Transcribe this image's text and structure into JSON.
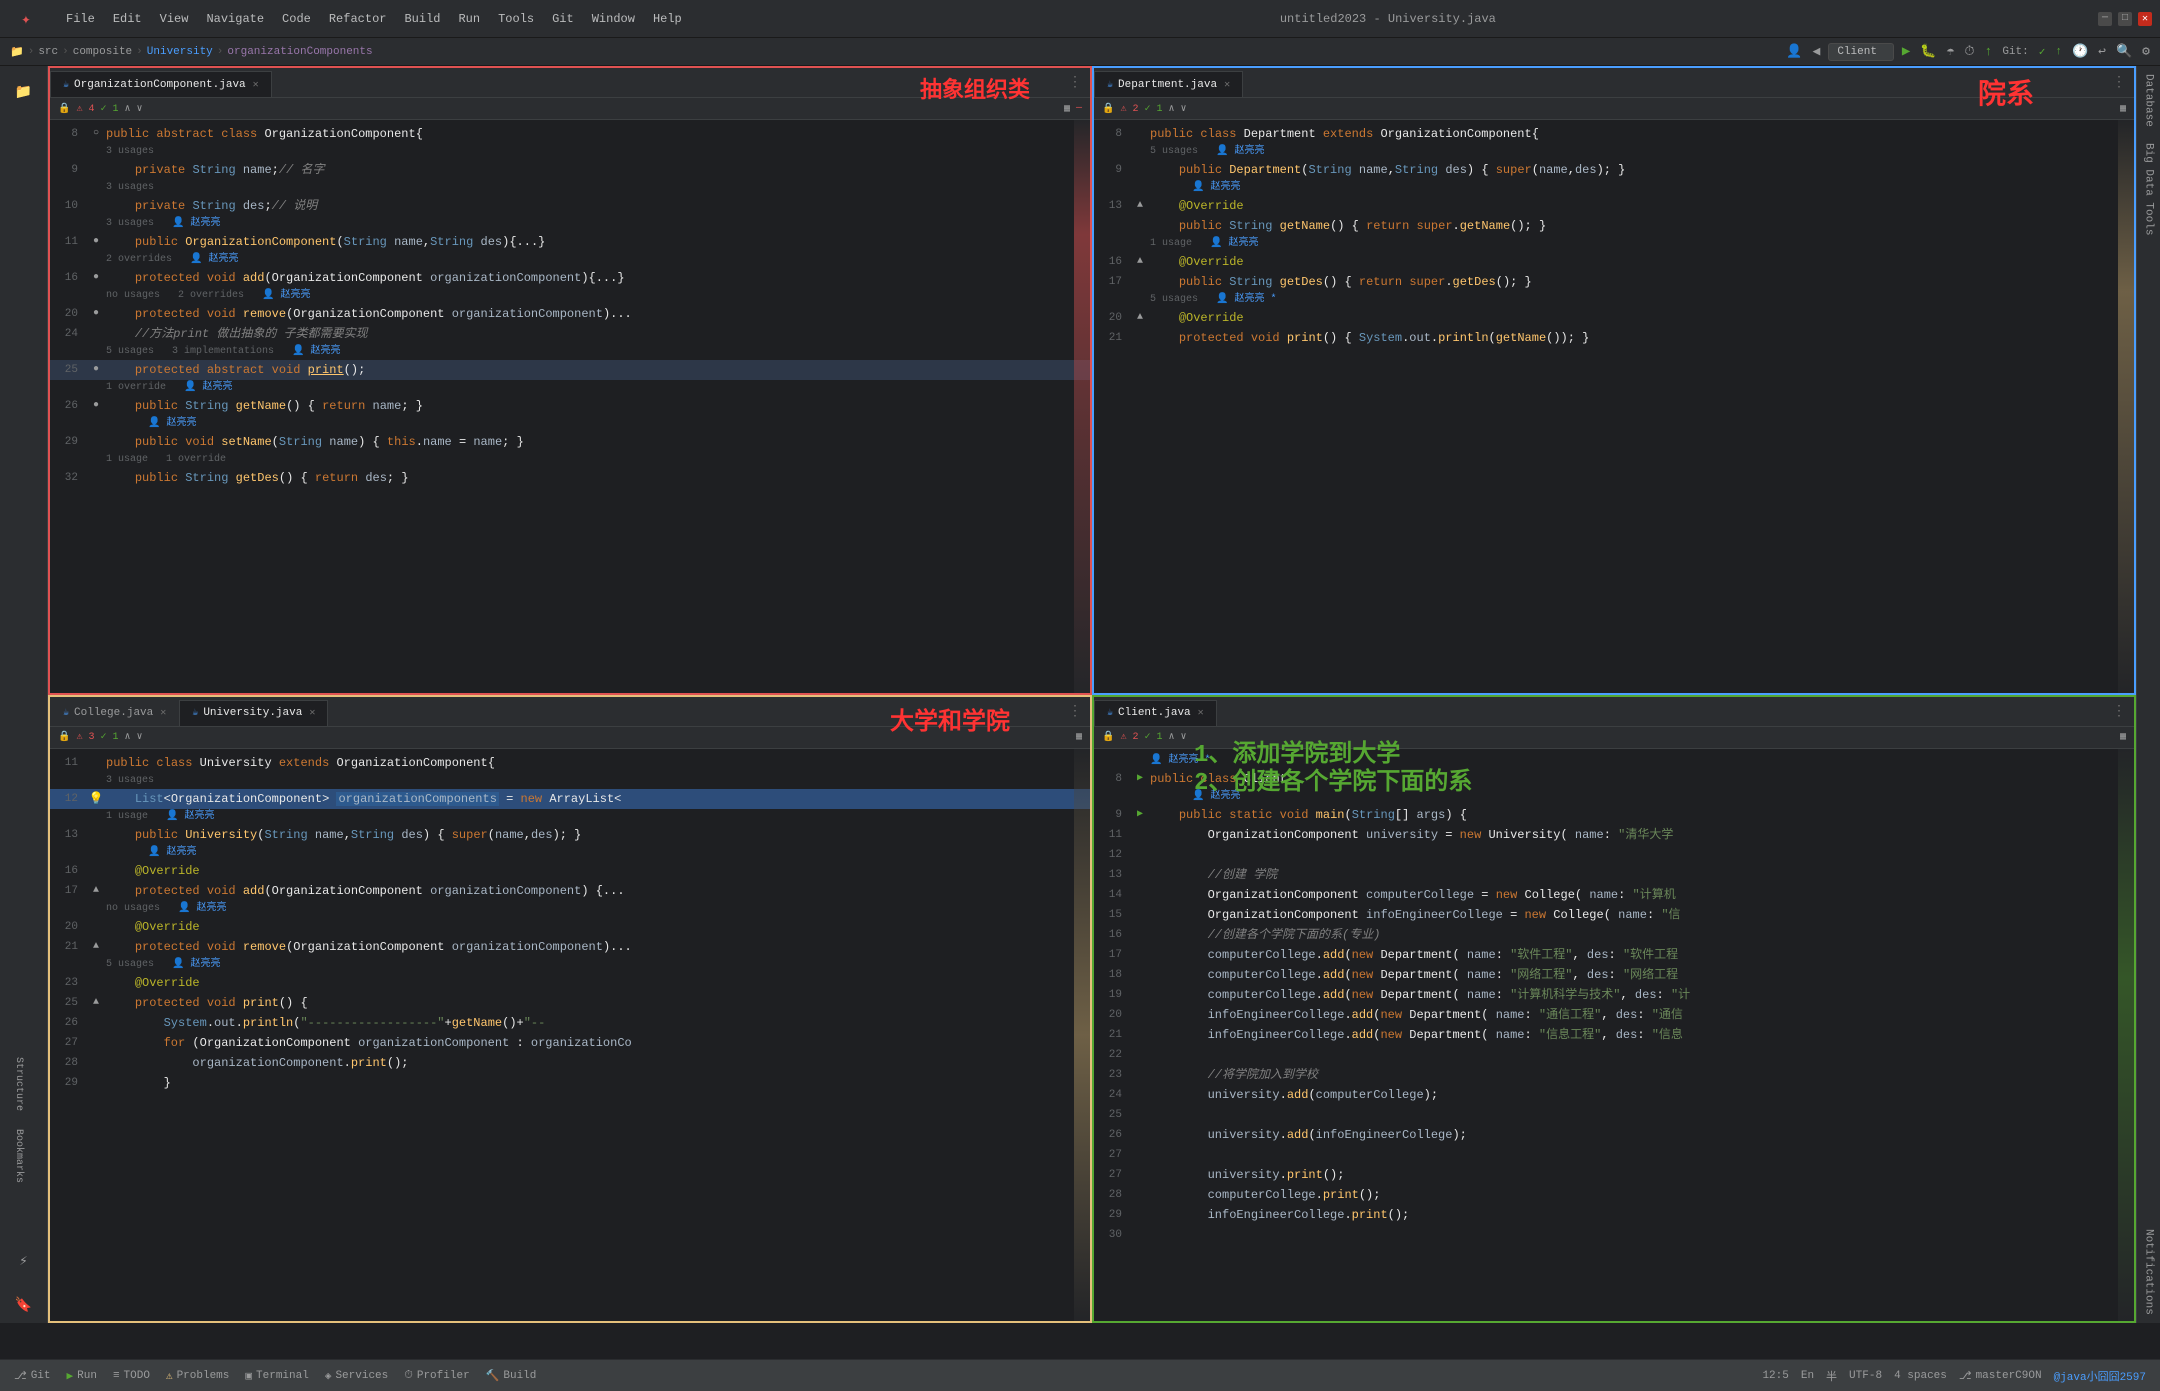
{
  "window": {
    "title": "untitled2023 - University.java"
  },
  "menu": {
    "items": [
      "File",
      "Edit",
      "View",
      "Navigate",
      "Code",
      "Refactor",
      "Build",
      "Run",
      "Tools",
      "Git",
      "Window",
      "Help"
    ]
  },
  "breadcrumb": {
    "items": [
      "untitled2023",
      "src",
      "composite",
      "University",
      "organizationComponents"
    ]
  },
  "toolbar": {
    "client_label": "Client",
    "git_label": "Git:"
  },
  "pane_top_left": {
    "tab_label": "OrganizationComponent.java",
    "annotation": "抽象组织类",
    "lines": []
  },
  "pane_top_right": {
    "tab_label": "Department.java",
    "annotation": "院系",
    "lines": []
  },
  "pane_bottom_left": {
    "tab1_label": "College.java",
    "tab2_label": "University.java",
    "annotation": "大学和学院",
    "lines": []
  },
  "pane_bottom_right": {
    "tab_label": "Client.java",
    "annotation1": "1、添加学院到大学",
    "annotation2": "2、创建各个学院下面的系",
    "lines": []
  },
  "status_bar": {
    "git_label": "Git",
    "run_label": "Run",
    "todo_label": "TODO",
    "problems_label": "Problems",
    "terminal_label": "Terminal",
    "services_label": "Services",
    "profiler_label": "Profiler",
    "build_label": "Build",
    "line_col": "12:5",
    "encoding": "En",
    "line_sep": "半",
    "encoding2": "UTF-8",
    "indent": "4 spaces",
    "git_branch": "masterC9ON",
    "user_info": "@java小囧囧2597"
  },
  "right_sidebar": {
    "items": [
      "Database",
      "Big Data Tools",
      "Notifications"
    ]
  }
}
